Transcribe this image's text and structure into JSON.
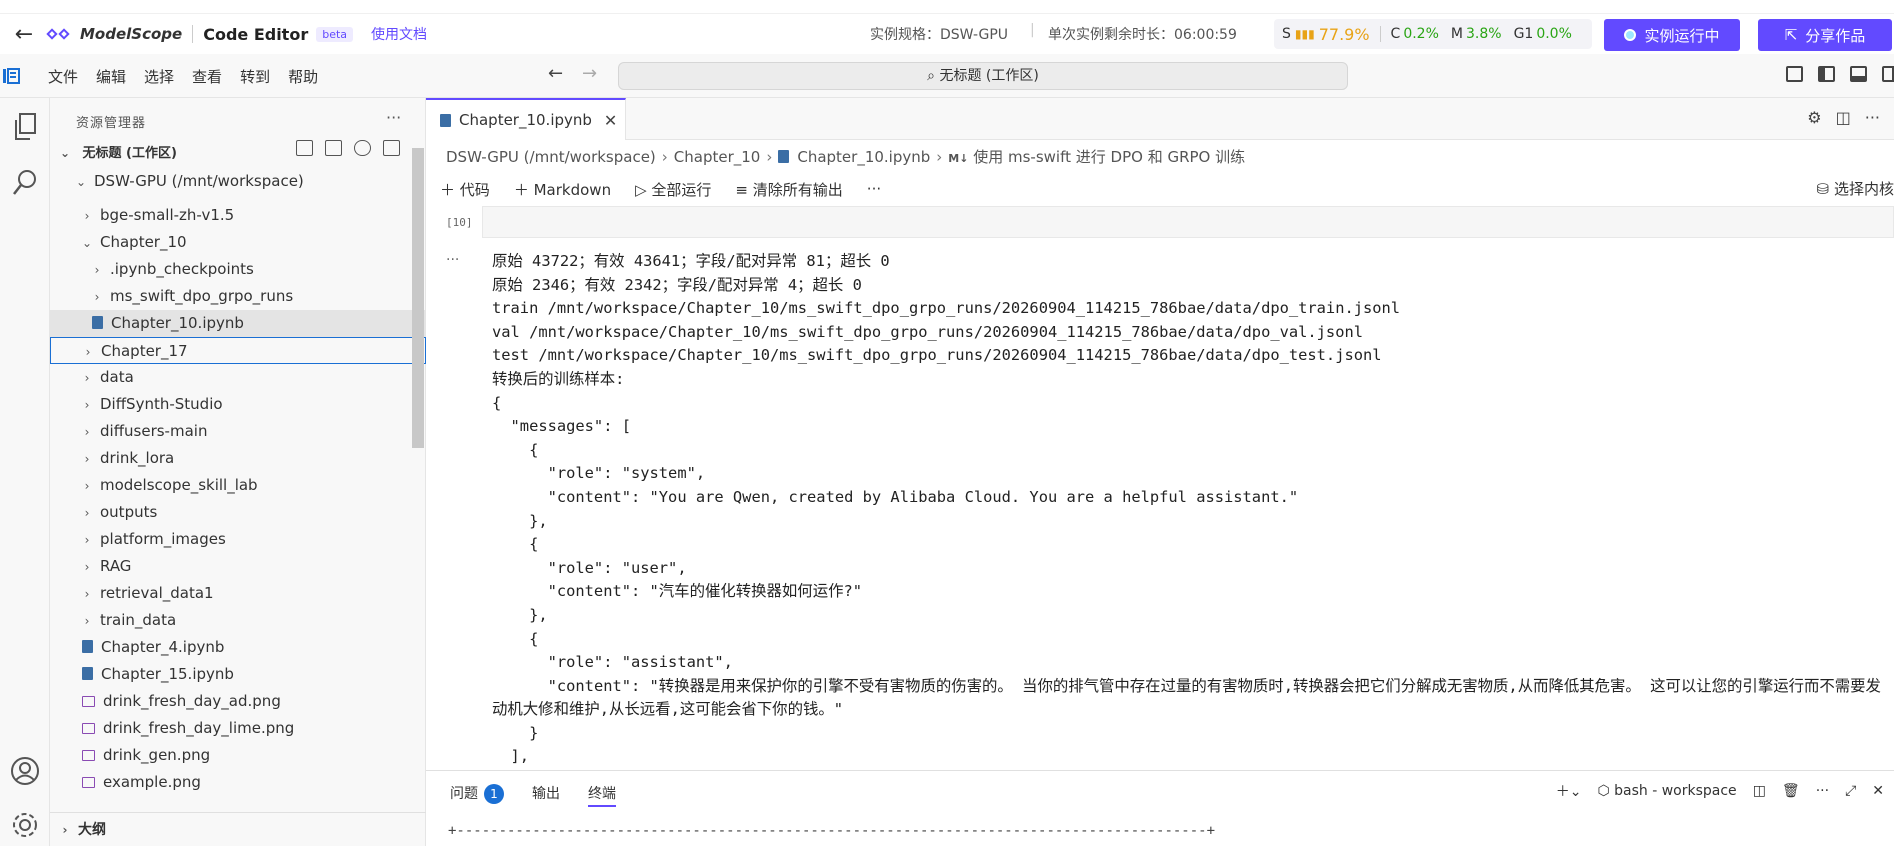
{
  "header": {
    "brand": "ModelScope",
    "product": "Code Editor",
    "beta": "beta",
    "doc_link": "使用文档",
    "spec": "实例规格：DSW-GPU",
    "remaining": "单次实例剩余时长：06:00:59",
    "res_s_label": "S",
    "res_s_value": "77.9%",
    "res_c_label": "C",
    "res_c_value": "0.2%",
    "res_m_label": "M",
    "res_m_value": "3.8%",
    "res_g_label": "G1",
    "res_g_value": "0.0%",
    "running_button": "实例运行中",
    "share_button": "分享作品",
    "colors": {
      "accent": "#624aff",
      "green": "#2aa515",
      "orange": "#e8a317"
    }
  },
  "menubar": {
    "items": [
      "文件",
      "编辑",
      "选择",
      "查看",
      "转到",
      "帮助"
    ],
    "search": "无标题 (工作区)"
  },
  "sidebar": {
    "title": "资源管理器",
    "workspace": "无标题 (工作区)",
    "root": "DSW-GPU (/mnt/workspace)",
    "items": [
      "bge-small-zh-v1.5",
      "Chapter_10",
      ".ipynb_checkpoints",
      "ms_swift_dpo_grpo_runs",
      "Chapter_10.ipynb",
      "Chapter_17",
      "data",
      "DiffSynth-Studio",
      "diffusers-main",
      "drink_lora",
      "modelscope_skill_lab",
      "outputs",
      "platform_images",
      "RAG",
      "retrieval_data1",
      "train_data",
      "Chapter_4.ipynb",
      "Chapter_15.ipynb",
      "drink_fresh_day_ad.png",
      "drink_fresh_day_lime.png",
      "drink_gen.png",
      "example.png"
    ],
    "outline": "大纲"
  },
  "editor": {
    "tab": "Chapter_10.ipynb",
    "breadcrumb": [
      "DSW-GPU (/mnt/workspace)",
      "Chapter_10",
      "Chapter_10.ipynb",
      "使用 ms-swift 进行 DPO 和 GRPO 训练"
    ],
    "breadcrumb_md_prefix": "M↓",
    "toolbar": [
      "代码",
      "Markdown",
      "全部运行",
      "清除所有输出"
    ],
    "kernel": "选择内核",
    "exec_count": "[10]",
    "output_lines": [
      "原始 43722；有效 43641；字段/配对异常 81；超长 0",
      "原始 2346；有效 2342；字段/配对异常 4；超长 0",
      "train /mnt/workspace/Chapter_10/ms_swift_dpo_grpo_runs/20260904_114215_786bae/data/dpo_train.jsonl",
      "val /mnt/workspace/Chapter_10/ms_swift_dpo_grpo_runs/20260904_114215_786bae/data/dpo_val.jsonl",
      "test /mnt/workspace/Chapter_10/ms_swift_dpo_grpo_runs/20260904_114215_786bae/data/dpo_test.jsonl",
      "转换后的训练样本:",
      "{",
      "  \"messages\": [",
      "    {",
      "      \"role\": \"system\",",
      "      \"content\": \"You are Qwen, created by Alibaba Cloud. You are a helpful assistant.\"",
      "    },",
      "    {",
      "      \"role\": \"user\",",
      "      \"content\": \"汽车的催化转换器如何运作?\"",
      "    },",
      "    {",
      "      \"role\": \"assistant\",",
      "      \"content\": \"转换器是用来保护你的引擎不受有害物质的伤害的。 当你的排气管中存在过量的有害物质时,转换器会把它们分解成无害物质,从而降低其危害。 这可以让您的引擎运行而不需要发动机大修和维护,从长远看,这可能会省下你的钱。\"",
      "    }",
      "  ],"
    ]
  },
  "panel": {
    "tabs": [
      "问题",
      "输出",
      "终端"
    ],
    "problems_count": "1",
    "terminal_name": "bash - workspace",
    "terminal_line": "+-----------------------------------------------------------------------------------------+"
  }
}
